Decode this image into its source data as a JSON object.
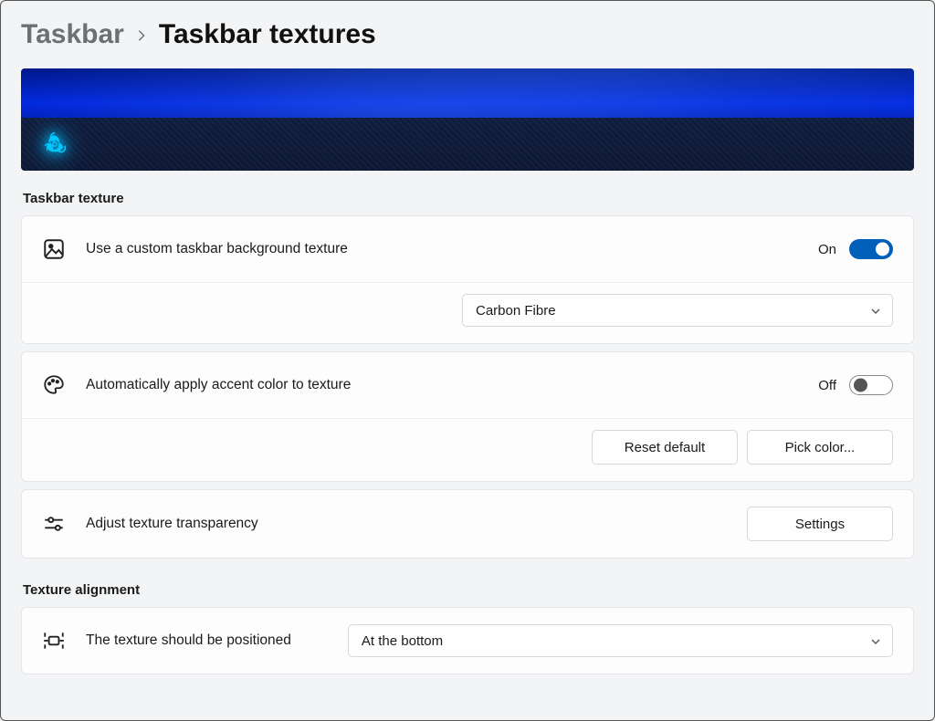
{
  "breadcrumb": {
    "parent": "Taskbar",
    "current": "Taskbar textures"
  },
  "texture_section": {
    "label": "Taskbar texture",
    "custom_bg": {
      "label": "Use a custom taskbar background texture",
      "state_label": "On",
      "state_on": true,
      "select_value": "Carbon Fibre"
    },
    "accent": {
      "label": "Automatically apply accent color to texture",
      "state_label": "Off",
      "state_on": false,
      "reset_btn": "Reset default",
      "pick_btn": "Pick color..."
    },
    "transparency": {
      "label": "Adjust texture transparency",
      "settings_btn": "Settings"
    }
  },
  "align_section": {
    "label": "Texture alignment",
    "position": {
      "label": "The texture should be positioned",
      "select_value": "At the bottom"
    }
  }
}
